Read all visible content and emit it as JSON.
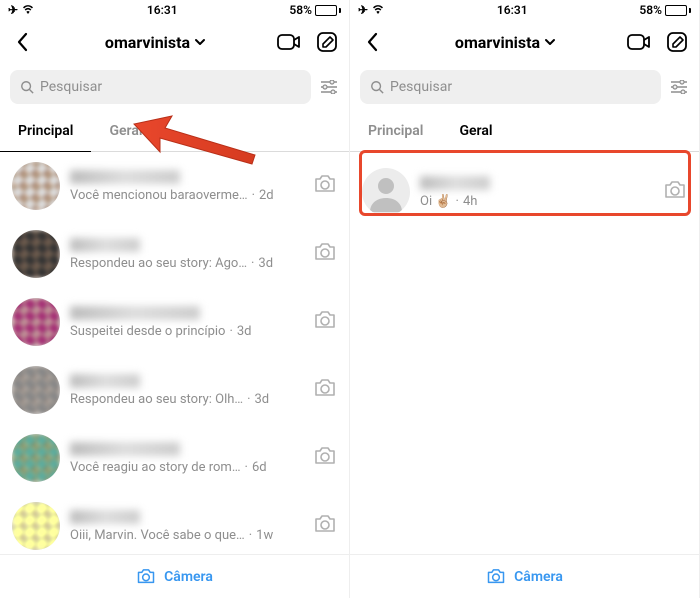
{
  "status": {
    "time": "16:31",
    "battery_pct": "58%"
  },
  "header": {
    "username": "omarvinista"
  },
  "search": {
    "placeholder": "Pesquisar"
  },
  "tabs": {
    "principal": "Principal",
    "geral": "Geral"
  },
  "left": {
    "active_tab": "principal",
    "chats": [
      {
        "preview": "Você mencionou baraoverme…",
        "time": "2d"
      },
      {
        "preview": "Respondeu ao seu story: Ago…",
        "time": "3d"
      },
      {
        "preview": "Suspeitei desde o princípio",
        "time": "3d"
      },
      {
        "preview": "Respondeu ao seu story: Olh…",
        "time": "3d"
      },
      {
        "preview": "Você reagiu ao story de rom…",
        "time": "6d"
      },
      {
        "preview": "Oiii, Marvin. Você sabe o que…",
        "time": "1w"
      }
    ]
  },
  "right": {
    "active_tab": "geral",
    "chats": [
      {
        "preview": "Oi ✌🏼",
        "time": "4h"
      }
    ]
  },
  "bottom": {
    "camera": "Câmera"
  }
}
